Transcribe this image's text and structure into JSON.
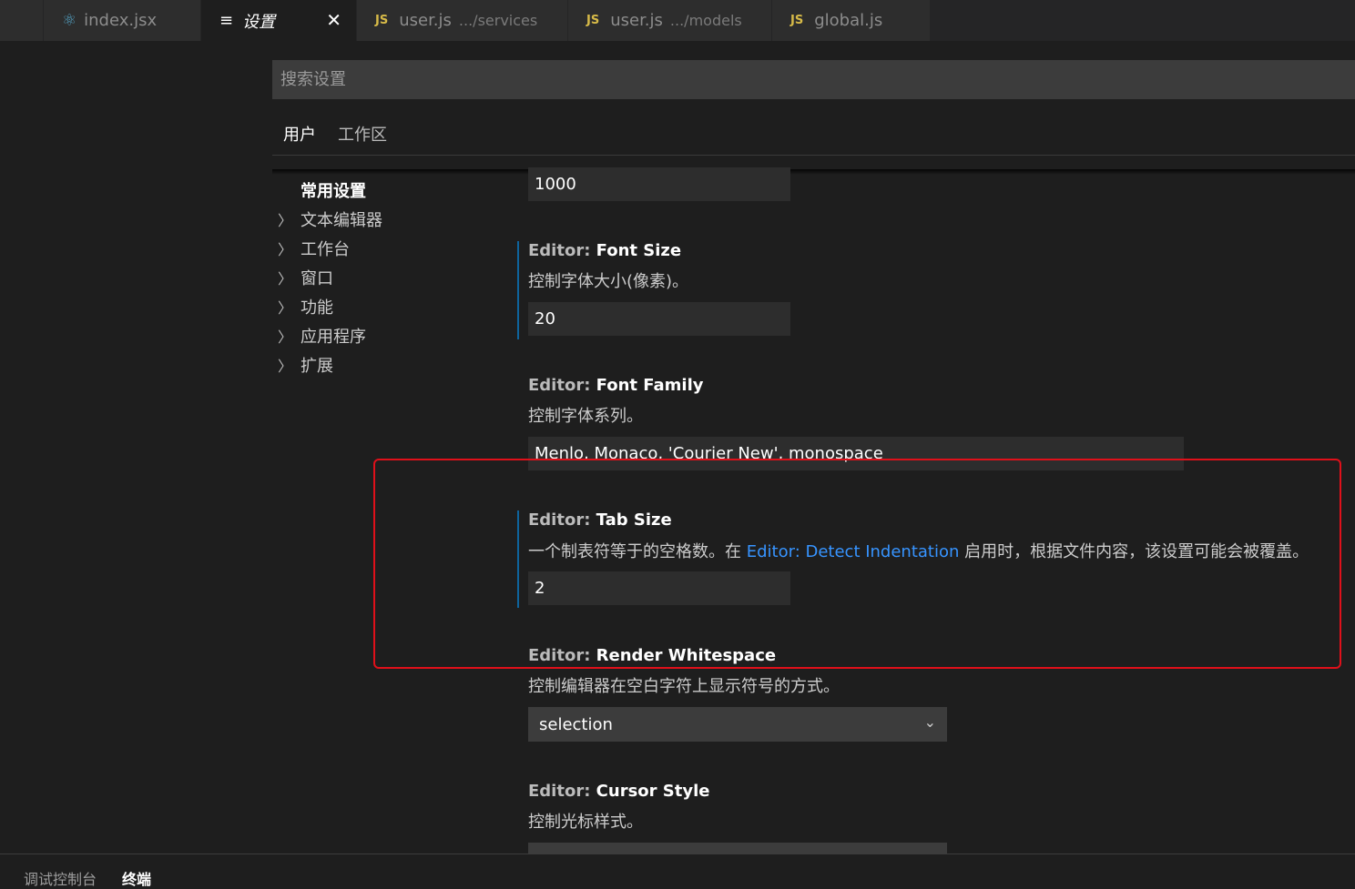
{
  "tabs": [
    {
      "icon": "react-icon",
      "glyph": "⚛",
      "label": "index.jsx",
      "desc": ""
    },
    {
      "icon": "settings-list-icon",
      "glyph": "≡",
      "label": "设置",
      "desc": "",
      "close": "✕"
    },
    {
      "icon": "js-icon",
      "glyph": "JS",
      "label": "user.js",
      "desc": ".../services"
    },
    {
      "icon": "js-icon",
      "glyph": "JS",
      "label": "user.js",
      "desc": ".../models"
    },
    {
      "icon": "js-icon",
      "glyph": "JS",
      "label": "global.js",
      "desc": ""
    }
  ],
  "search": {
    "placeholder": "搜索设置"
  },
  "scopes": [
    "用户",
    "工作区"
  ],
  "toc": {
    "head": "常用设置",
    "items": [
      "文本编辑器",
      "工作台",
      "窗口",
      "功能",
      "应用程序",
      "扩展"
    ],
    "chevron": "〉"
  },
  "settings": {
    "prev_value": "1000",
    "font_size": {
      "category": "Editor: ",
      "name": "Font Size",
      "desc": "控制字体大小(像素)。",
      "value": "20"
    },
    "font_family": {
      "category": "Editor: ",
      "name": "Font Family",
      "desc": "控制字体系列。",
      "value": "Menlo, Monaco, 'Courier New', monospace"
    },
    "tab_size": {
      "category": "Editor: ",
      "name": "Tab Size",
      "desc_before": "一个制表符等于的空格数。在 ",
      "desc_link": "Editor: Detect Indentation",
      "desc_after": " 启用时，根据文件内容，该设置可能会被覆盖。",
      "value": "2"
    },
    "render_whitespace": {
      "category": "Editor: ",
      "name": "Render Whitespace",
      "desc": "控制编辑器在空白字符上显示符号的方式。",
      "value": "selection",
      "caret": "⌄"
    },
    "cursor_style": {
      "category": "Editor: ",
      "name": "Cursor Style",
      "desc": "控制光标样式。"
    }
  },
  "panel": {
    "tabs": [
      "调试控制台",
      "终端"
    ]
  },
  "colors": {
    "accent": "#0e639c",
    "link": "#3794ff",
    "highlight": "#e0101a",
    "js": "#d7ba48"
  }
}
